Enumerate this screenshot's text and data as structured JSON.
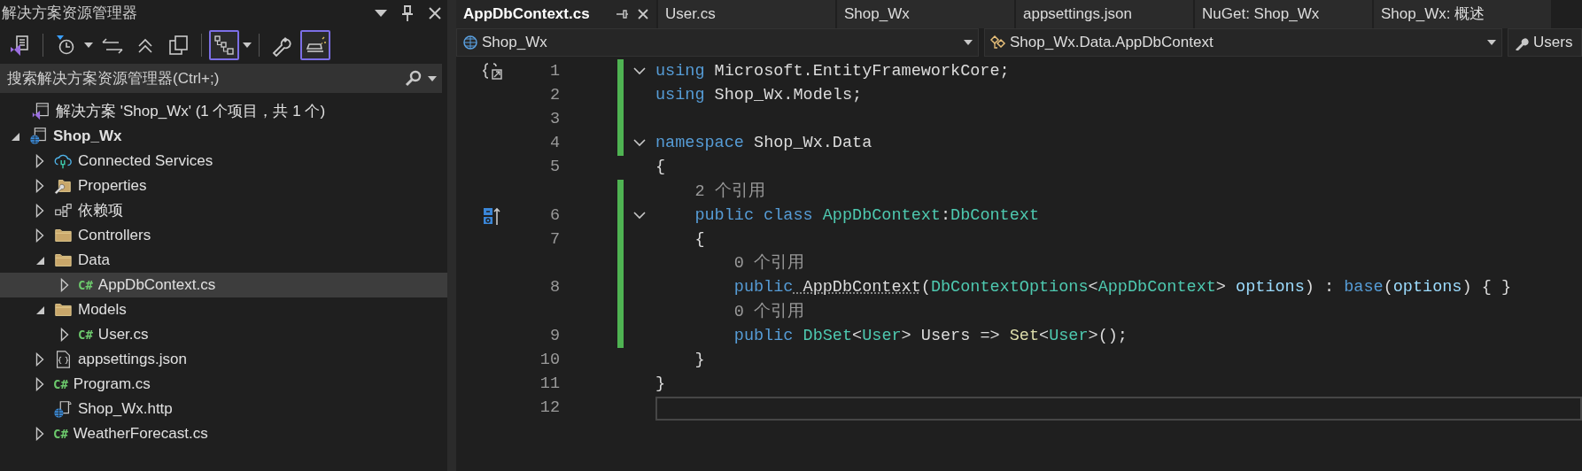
{
  "explorer": {
    "title": "解决方案资源管理器",
    "toolbar": [
      {
        "kind": "vs-doc",
        "selected": false
      },
      {
        "kind": "separator"
      },
      {
        "kind": "history",
        "selected": false,
        "has_menu": true
      },
      {
        "kind": "sync",
        "selected": false
      },
      {
        "kind": "collapse",
        "selected": false
      },
      {
        "kind": "pages",
        "selected": false
      },
      {
        "kind": "separator"
      },
      {
        "kind": "tree-view",
        "selected": true,
        "has_menu": true
      },
      {
        "kind": "separator"
      },
      {
        "kind": "wrench",
        "selected": false
      },
      {
        "kind": "preview",
        "selected": true
      }
    ],
    "search": {
      "placeholder": "搜索解决方案资源管理器(Ctrl+;)"
    },
    "tree": [
      {
        "label": "解决方案 'Shop_Wx' (1 个项目，共 1 个)",
        "kind": "solution",
        "selected": false,
        "children": [
          {
            "label": "Shop_Wx",
            "kind": "project",
            "bold": true,
            "expanded": true,
            "selected": false,
            "children": [
              {
                "label": "Connected Services",
                "kind": "connected",
                "expanded": false,
                "selected": false
              },
              {
                "label": "Properties",
                "kind": "properties",
                "expanded": false,
                "selected": false
              },
              {
                "label": "依赖项",
                "kind": "dependencies",
                "expanded": false,
                "selected": false
              },
              {
                "label": "Controllers",
                "kind": "folder",
                "expanded": false,
                "selected": false
              },
              {
                "label": "Data",
                "kind": "folder",
                "expanded": true,
                "selected": false,
                "children": [
                  {
                    "label": "AppDbContext.cs",
                    "kind": "csharp",
                    "icon_text": "C#",
                    "expanded": false,
                    "selected": true
                  }
                ]
              },
              {
                "label": "Models",
                "kind": "folder",
                "expanded": true,
                "selected": false,
                "children": [
                  {
                    "label": "User.cs",
                    "kind": "csharp",
                    "icon_text": "C#",
                    "expanded": false,
                    "selected": false
                  }
                ]
              },
              {
                "label": "appsettings.json",
                "kind": "json",
                "expanded": false,
                "selected": false
              },
              {
                "label": "Program.cs",
                "kind": "csharp",
                "icon_text": "C#",
                "expanded": false,
                "selected": false
              },
              {
                "label": "Shop_Wx.http",
                "kind": "http",
                "selected": false
              },
              {
                "label": "WeatherForecast.cs",
                "kind": "csharp",
                "icon_text": "C#",
                "expanded": false,
                "selected": false
              }
            ]
          }
        ]
      }
    ]
  },
  "tabs": [
    {
      "label": "AppDbContext.cs",
      "selected": true
    },
    {
      "label": "User.cs",
      "selected": false
    },
    {
      "label": "Shop_Wx",
      "selected": false
    },
    {
      "label": "appsettings.json",
      "selected": false
    },
    {
      "label": "NuGet: Shop_Wx",
      "selected": false
    },
    {
      "label": "Shop_Wx: 概述",
      "selected": false
    }
  ],
  "navigation": [
    {
      "label": "Shop_Wx",
      "kind": "project"
    },
    {
      "label": "Shop_Wx.Data.AppDbContext",
      "kind": "class"
    },
    {
      "label": "Users",
      "kind": "property"
    }
  ],
  "code": {
    "lines": [
      {
        "kind": "code",
        "number": "1",
        "changed": true,
        "expanded": true,
        "gutter": {
          "kind": "usings"
        },
        "tokens": [
          {
            "kind": "keyword",
            "text": "using"
          },
          {
            "kind": "plain",
            "text": " Microsoft.EntityFrameworkCore;"
          }
        ]
      },
      {
        "kind": "code",
        "number": "2",
        "changed": true,
        "tokens": [
          {
            "kind": "keyword",
            "text": "using"
          },
          {
            "kind": "plain",
            "text": " Shop_Wx.Models;"
          }
        ]
      },
      {
        "kind": "code",
        "number": "3",
        "changed": true
      },
      {
        "kind": "code",
        "number": "4",
        "changed": true,
        "expanded": true,
        "tokens": [
          {
            "kind": "keyword",
            "text": "namespace"
          },
          {
            "kind": "plain",
            "text": " Shop_Wx.Data"
          }
        ]
      },
      {
        "kind": "code",
        "number": "5",
        "changed": false,
        "tokens": [
          {
            "kind": "plain",
            "text": "{"
          }
        ]
      },
      {
        "kind": "lens",
        "changed": true,
        "text": "    2 个引用"
      },
      {
        "kind": "code",
        "number": "6",
        "changed": true,
        "expanded": true,
        "gutter": {
          "kind": "class"
        },
        "tokens": [
          {
            "kind": "keyword",
            "text": "    public class"
          },
          {
            "kind": "type",
            "text": " AppDbContext"
          },
          {
            "kind": "plain",
            "text": ":"
          },
          {
            "kind": "type",
            "text": "DbContext"
          }
        ]
      },
      {
        "kind": "code",
        "number": "7",
        "changed": true,
        "tokens": [
          {
            "kind": "plain",
            "text": "    {"
          }
        ]
      },
      {
        "kind": "lens",
        "changed": true,
        "text": "        0 个引用"
      },
      {
        "kind": "code",
        "number": "8",
        "changed": true,
        "tokens": [
          {
            "kind": "keyword",
            "text": "        public"
          },
          {
            "kind": "ctor",
            "text": " AppDbContext"
          },
          {
            "kind": "plain",
            "text": "("
          },
          {
            "kind": "type",
            "text": "DbContextOptions"
          },
          {
            "kind": "plain",
            "text": "<"
          },
          {
            "kind": "type",
            "text": "AppDbContext"
          },
          {
            "kind": "plain",
            "text": "> "
          },
          {
            "kind": "param",
            "text": "options"
          },
          {
            "kind": "plain",
            "text": ") : "
          },
          {
            "kind": "keyword",
            "text": "base"
          },
          {
            "kind": "plain",
            "text": "("
          },
          {
            "kind": "param",
            "text": "options"
          },
          {
            "kind": "plain",
            "text": ") { }"
          }
        ]
      },
      {
        "kind": "lens",
        "changed": true,
        "text": "        0 个引用"
      },
      {
        "kind": "code",
        "number": "9",
        "changed": true,
        "tokens": [
          {
            "kind": "keyword",
            "text": "        public"
          },
          {
            "kind": "type",
            "text": " DbSet"
          },
          {
            "kind": "plain",
            "text": "<"
          },
          {
            "kind": "type",
            "text": "User"
          },
          {
            "kind": "plain",
            "text": "> Users => "
          },
          {
            "kind": "method",
            "text": "Set"
          },
          {
            "kind": "plain",
            "text": "<"
          },
          {
            "kind": "type",
            "text": "User"
          },
          {
            "kind": "plain",
            "text": ">();"
          }
        ]
      },
      {
        "kind": "code",
        "number": "10",
        "changed": false,
        "tokens": [
          {
            "kind": "plain",
            "text": "    }"
          }
        ]
      },
      {
        "kind": "code",
        "number": "11",
        "changed": false,
        "tokens": [
          {
            "kind": "plain",
            "text": "}"
          }
        ]
      },
      {
        "kind": "code",
        "number": "12",
        "changed": false,
        "current": true
      }
    ]
  }
}
